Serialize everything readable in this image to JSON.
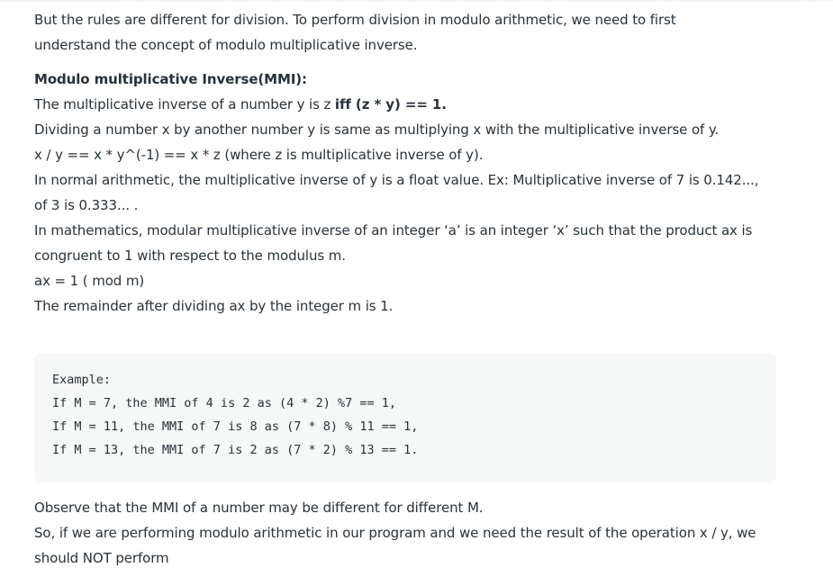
{
  "intro": {
    "line1": "But the rules are different for division. To perform division in modulo arithmetic, we need to first",
    "line2": "understand the concept of modulo multiplicative inverse."
  },
  "mmi_section": {
    "heading": "Modulo multiplicative Inverse(MMI):",
    "def_prefix": "The multiplicative inverse of a number y is z ",
    "def_bold": "iff (z * y) == 1.",
    "divide_line": "Dividing a number x by another number y is same as multiplying x with the multiplicative inverse of y.",
    "formula_line": "x / y == x * y^(-1) == x * z (where z is multiplicative inverse of y).",
    "normal_line1": "In normal arithmetic, the multiplicative inverse of y is a float value. Ex: Multiplicative inverse of 7 is 0.142...,",
    "normal_line2": "of 3 is 0.333... .",
    "math_line1": "In mathematics, modular multiplicative inverse of an integer ‘a’ is an integer ‘x’ such that the product ax is",
    "math_line2": "congruent to 1 with respect to the modulus m.",
    "congruence": "ax = 1 ( mod m)",
    "remainder_line": "The remainder after dividing ax by the integer m is 1."
  },
  "example_block": {
    "lines": [
      "Example:",
      "If M = 7, the MMI of 4 is 2 as (4 * 2) %7 == 1,",
      "If M = 11, the MMI of 7 is 8 as (7 * 8) % 11 == 1,",
      "If M = 13, the MMI of 7 is 2 as (7 * 2) % 13 == 1."
    ]
  },
  "outro": {
    "line1": "Observe that the MMI of a number may be different for different M.",
    "line2": "So, if we are performing modulo arithmetic in our program and we need the result of the operation x / y, we",
    "line3": "should NOT perform"
  }
}
